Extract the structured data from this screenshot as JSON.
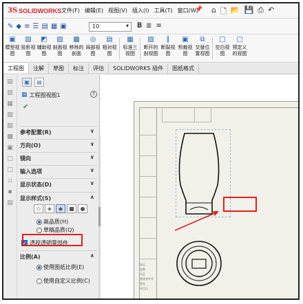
{
  "app": {
    "brand_prefix": "3S",
    "brand_name": "SOLIDWORKS"
  },
  "menu": [
    "文件(F)",
    "编辑(E)",
    "视图(V)",
    "插入(I)",
    "工具(T)",
    "窗口(W)"
  ],
  "line_field": {
    "value": "10"
  },
  "ribbon": {
    "buttons": [
      {
        "label1": "模型视",
        "label2": "图",
        "icon": "model-view-icon"
      },
      {
        "label1": "投影视",
        "label2": "图",
        "icon": "projected-view-icon"
      },
      {
        "label1": "辅助视",
        "label2": "图",
        "icon": "auxiliary-view-icon"
      },
      {
        "label1": "剖面视",
        "label2": "图",
        "icon": "section-view-icon"
      },
      {
        "label1": "移除的",
        "label2": "剖面",
        "icon": "removed-section-icon"
      },
      {
        "label1": "局部视",
        "label2": "图",
        "icon": "detail-view-icon"
      },
      {
        "label1": "相对视",
        "label2": "图",
        "icon": "relative-view-icon"
      },
      {
        "label1": "标准三",
        "label2": "视图",
        "icon": "standard-3-view-icon"
      },
      {
        "label1": "断开的",
        "label2": "剖视图",
        "icon": "broken-out-section-icon"
      },
      {
        "label1": "断裂视",
        "label2": "图",
        "icon": "break-view-icon"
      },
      {
        "label1": "剪裁视",
        "label2": "图",
        "icon": "crop-view-icon"
      },
      {
        "label1": "交替位",
        "label2": "置视图",
        "icon": "alternate-position-icon"
      },
      {
        "label1": "空白视",
        "label2": "图",
        "icon": "empty-view-icon"
      },
      {
        "label1": "预定义",
        "label2": "的视图",
        "icon": "predefined-view-icon"
      }
    ]
  },
  "tabs": [
    "工程图",
    "注解",
    "草图",
    "标注",
    "评估",
    "SOLIDWORKS 插件",
    "图纸格式"
  ],
  "panel": {
    "title": "工程图视图1",
    "help": "?",
    "sections": {
      "reference_config": "参考配置(R)",
      "orientation": "方向(O)",
      "mirror": "镜向",
      "import_options": "输入选项",
      "display_state": "显示状态(D)",
      "display_style": "显示样式(S)",
      "scale": "比例(A)"
    },
    "quality": {
      "high": "高品质(H)",
      "draft": "草稿品质(Q)"
    },
    "transparent_checkbox": "透视透明零部件",
    "scale_options": {
      "sheet": "使用图纸比例(E)",
      "custom": "使用自定义比例(C)"
    }
  },
  "sheet": {
    "title_block_labels": [
      "标记",
      "处数",
      "分区",
      "更改文件号",
      "签名",
      "年月日"
    ]
  }
}
